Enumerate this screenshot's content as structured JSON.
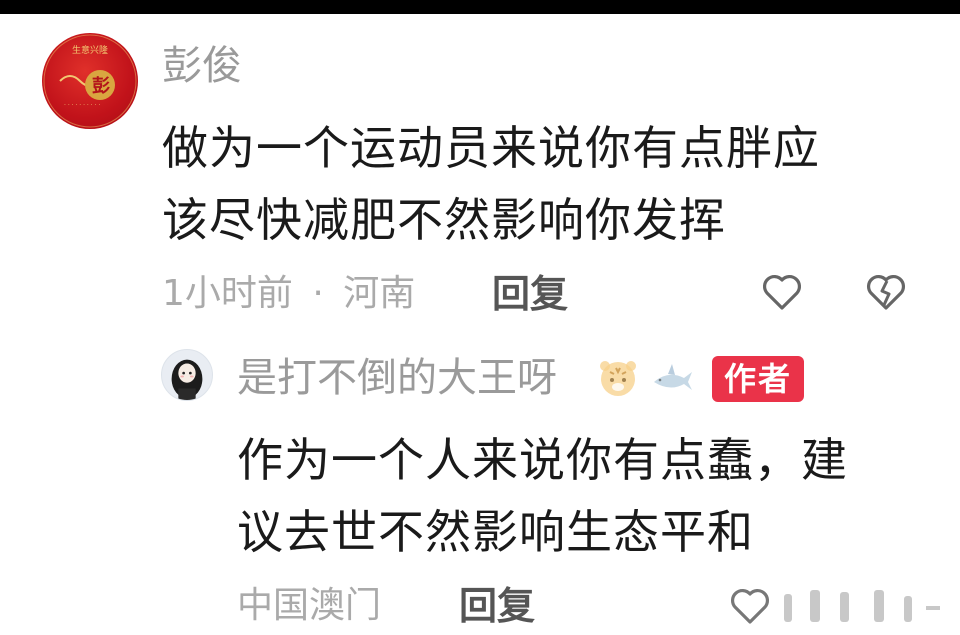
{
  "comments": [
    {
      "username": "彭俊",
      "avatar_text": "彭",
      "text_lines": [
        "做为一个运动员来说你有点胖应",
        "该尽快减肥不然影响你发挥"
      ],
      "time": "1小时前",
      "location": "河南",
      "separator": "·",
      "reply_label": "回复",
      "like_icon": "heart-outline-icon",
      "dislike_icon": "broken-heart-icon"
    },
    {
      "username": "是打不倒的大王呀",
      "badge_emojis": [
        "tiger-emoji-icon",
        "shark-emoji-icon"
      ],
      "author_badge": "作者",
      "text_lines": [
        "作为一个人来说你有点蠢，建",
        "议去世不然影响生态平和"
      ],
      "location": "中国澳门",
      "reply_label": "回复",
      "like_icon": "heart-outline-icon"
    }
  ],
  "colors": {
    "author_badge_bg": "#ea3349",
    "text_primary": "#1a1a1a",
    "text_secondary": "#9a9a9a"
  }
}
